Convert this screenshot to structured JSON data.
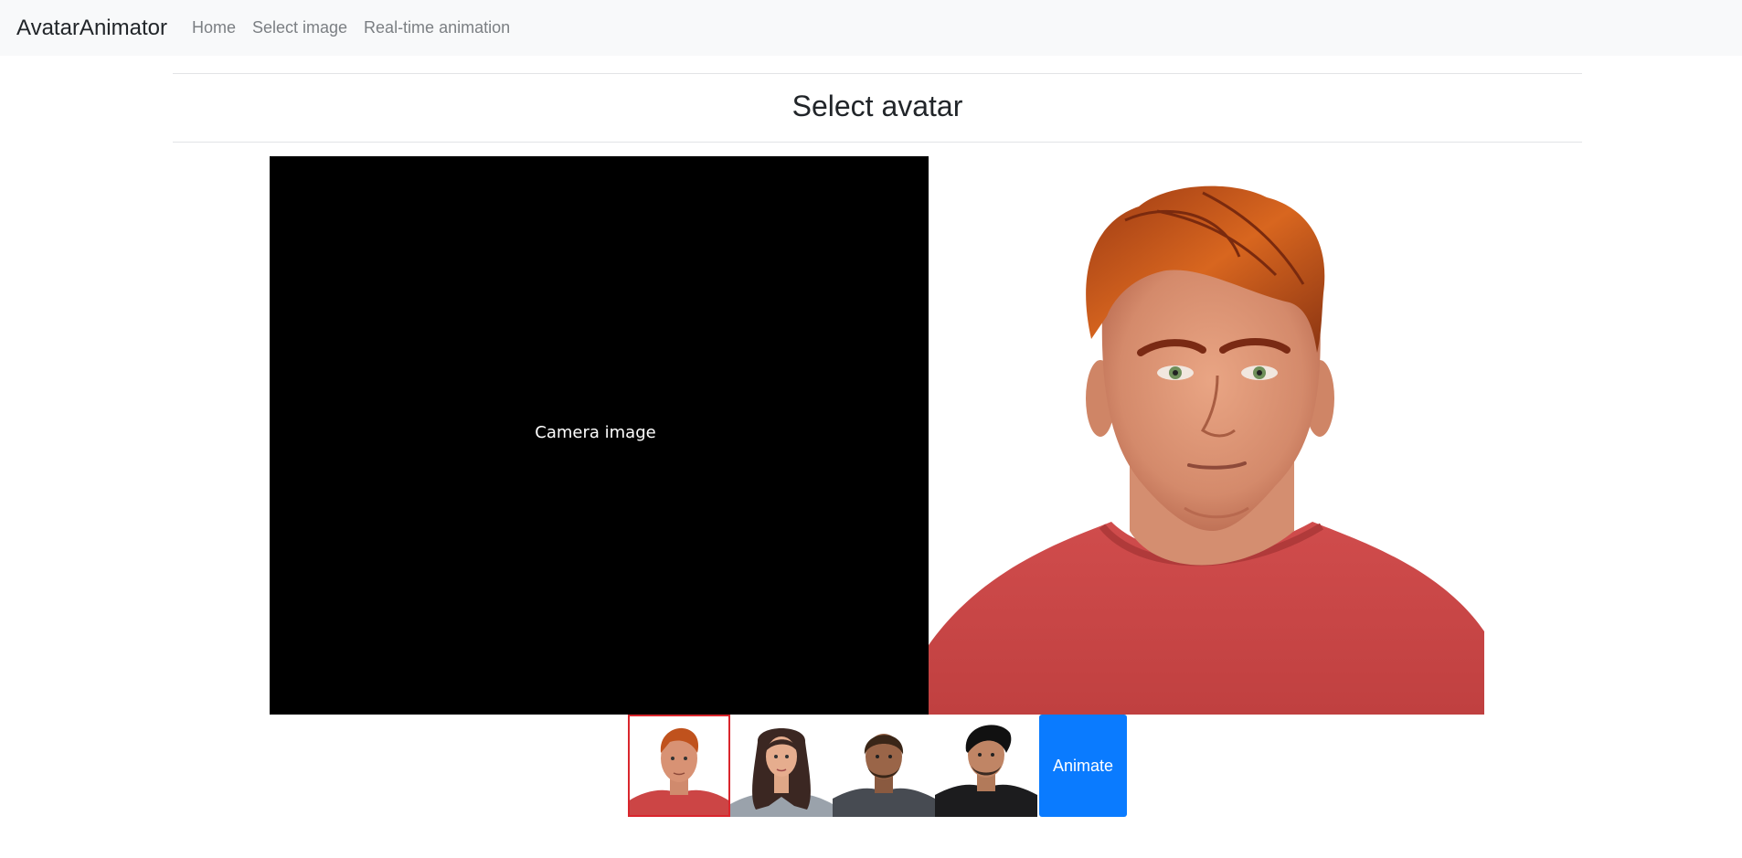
{
  "navbar": {
    "brand": "AvatarAnimator",
    "links": [
      {
        "label": "Home"
      },
      {
        "label": "Select image"
      },
      {
        "label": "Real-time animation"
      }
    ]
  },
  "main": {
    "title": "Select avatar",
    "camera_label": "Camera image",
    "animate_label": "Animate"
  },
  "avatars": {
    "selected_index": 0,
    "items": [
      {
        "name": "red-haired-man",
        "selected": true
      },
      {
        "name": "long-haired-woman",
        "selected": false
      },
      {
        "name": "bearded-man",
        "selected": false
      },
      {
        "name": "black-haired-man",
        "selected": false
      }
    ]
  },
  "colors": {
    "navbar_bg": "#f8f9fa",
    "selection_border": "#d9262d",
    "animate_button": "#0a7bff",
    "camera_bg": "#000000",
    "shirt_red": "#c94545"
  }
}
